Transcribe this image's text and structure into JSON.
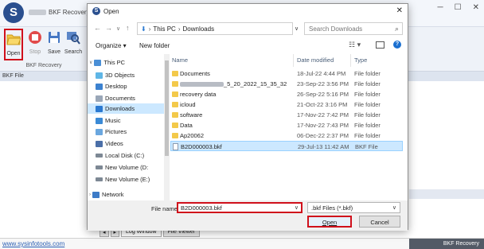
{
  "app": {
    "title": "BKF Recovery",
    "ribbon_group": "BKF Recovery",
    "pane_header": "BKF File",
    "buttons": [
      {
        "label": "Open",
        "icon": "folder-open-icon"
      },
      {
        "label": "Stop",
        "icon": "stop-icon"
      },
      {
        "label": "Save",
        "icon": "save-icon"
      },
      {
        "label": "Search",
        "icon": "search-icon"
      }
    ],
    "tabs": {
      "log": "Log Window",
      "viewer": "File Viewer"
    },
    "status_link": "www.sysinfotools.com",
    "status_right": "BKF Recovery",
    "window_controls": {
      "minimize": "─",
      "maximize": "☐",
      "close": "✕"
    }
  },
  "dialog": {
    "title": "Open",
    "close": "✕",
    "breadcrumb": [
      "This PC",
      "Downloads"
    ],
    "search_placeholder": "Search Downloads",
    "organize": "Organize ▾",
    "new_folder": "New folder",
    "nav_items": [
      {
        "label": "This PC",
        "icon": "pc-icon",
        "color": "#4a8fd6"
      },
      {
        "label": "3D Objects",
        "icon": "cube-icon",
        "color": "#5fb6e6"
      },
      {
        "label": "Desktop",
        "icon": "desktop-icon",
        "color": "#3c82d0"
      },
      {
        "label": "Documents",
        "icon": "documents-icon",
        "color": "#9aa7b8"
      },
      {
        "label": "Downloads",
        "icon": "download-icon",
        "color": "#2b79d1"
      },
      {
        "label": "Music",
        "icon": "music-icon",
        "color": "#3a8ad6"
      },
      {
        "label": "Pictures",
        "icon": "pictures-icon",
        "color": "#6aa7df"
      },
      {
        "label": "Videos",
        "icon": "videos-icon",
        "color": "#4b6fa8"
      },
      {
        "label": "Local Disk (C:)",
        "icon": "disk-icon",
        "color": "#7d8894"
      },
      {
        "label": "New Volume (D:",
        "icon": "disk-icon",
        "color": "#7d8894"
      },
      {
        "label": "New Volume (E:)",
        "icon": "disk-icon",
        "color": "#7d8894"
      },
      {
        "label": "Network",
        "icon": "network-icon",
        "color": "#3d7bc7"
      }
    ],
    "columns": {
      "name": "Name",
      "date": "Date modified",
      "type": "Type"
    },
    "files": [
      {
        "name": "Documents",
        "date": "18-Jul-22 4:44 PM",
        "type": "File folder",
        "kind": "folder"
      },
      {
        "name": "_5_20_2022_15_35_32",
        "date": "23-Sep-22 3:56 PM",
        "type": "File folder",
        "kind": "folder"
      },
      {
        "name": "recovery data",
        "date": "26-Sep-22 5:16 PM",
        "type": "File folder",
        "kind": "folder"
      },
      {
        "name": "icloud",
        "date": "21-Oct-22 3:16 PM",
        "type": "File folder",
        "kind": "folder"
      },
      {
        "name": "software",
        "date": "17-Nov-22 7:42 PM",
        "type": "File folder",
        "kind": "folder"
      },
      {
        "name": "Data",
        "date": "17-Nov-22 7:43 PM",
        "type": "File folder",
        "kind": "folder"
      },
      {
        "name": "Ap20062",
        "date": "06-Dec-22 2:37 PM",
        "type": "File folder",
        "kind": "folder"
      },
      {
        "name": "B2D000003.bkf",
        "date": "29-Jul-13 11:42 AM",
        "type": "BKF File",
        "kind": "file"
      }
    ],
    "file_name_label": "File name:",
    "file_name_value": "B2D000003.bkf",
    "filter": ".bkf Files (*.bkf)",
    "open_button": "Open",
    "cancel_button": "Cancel"
  },
  "colors": {
    "highlight_red": "#d0101b",
    "selection_blue": "#cce8ff",
    "brand_blue": "#2a4f8f"
  }
}
